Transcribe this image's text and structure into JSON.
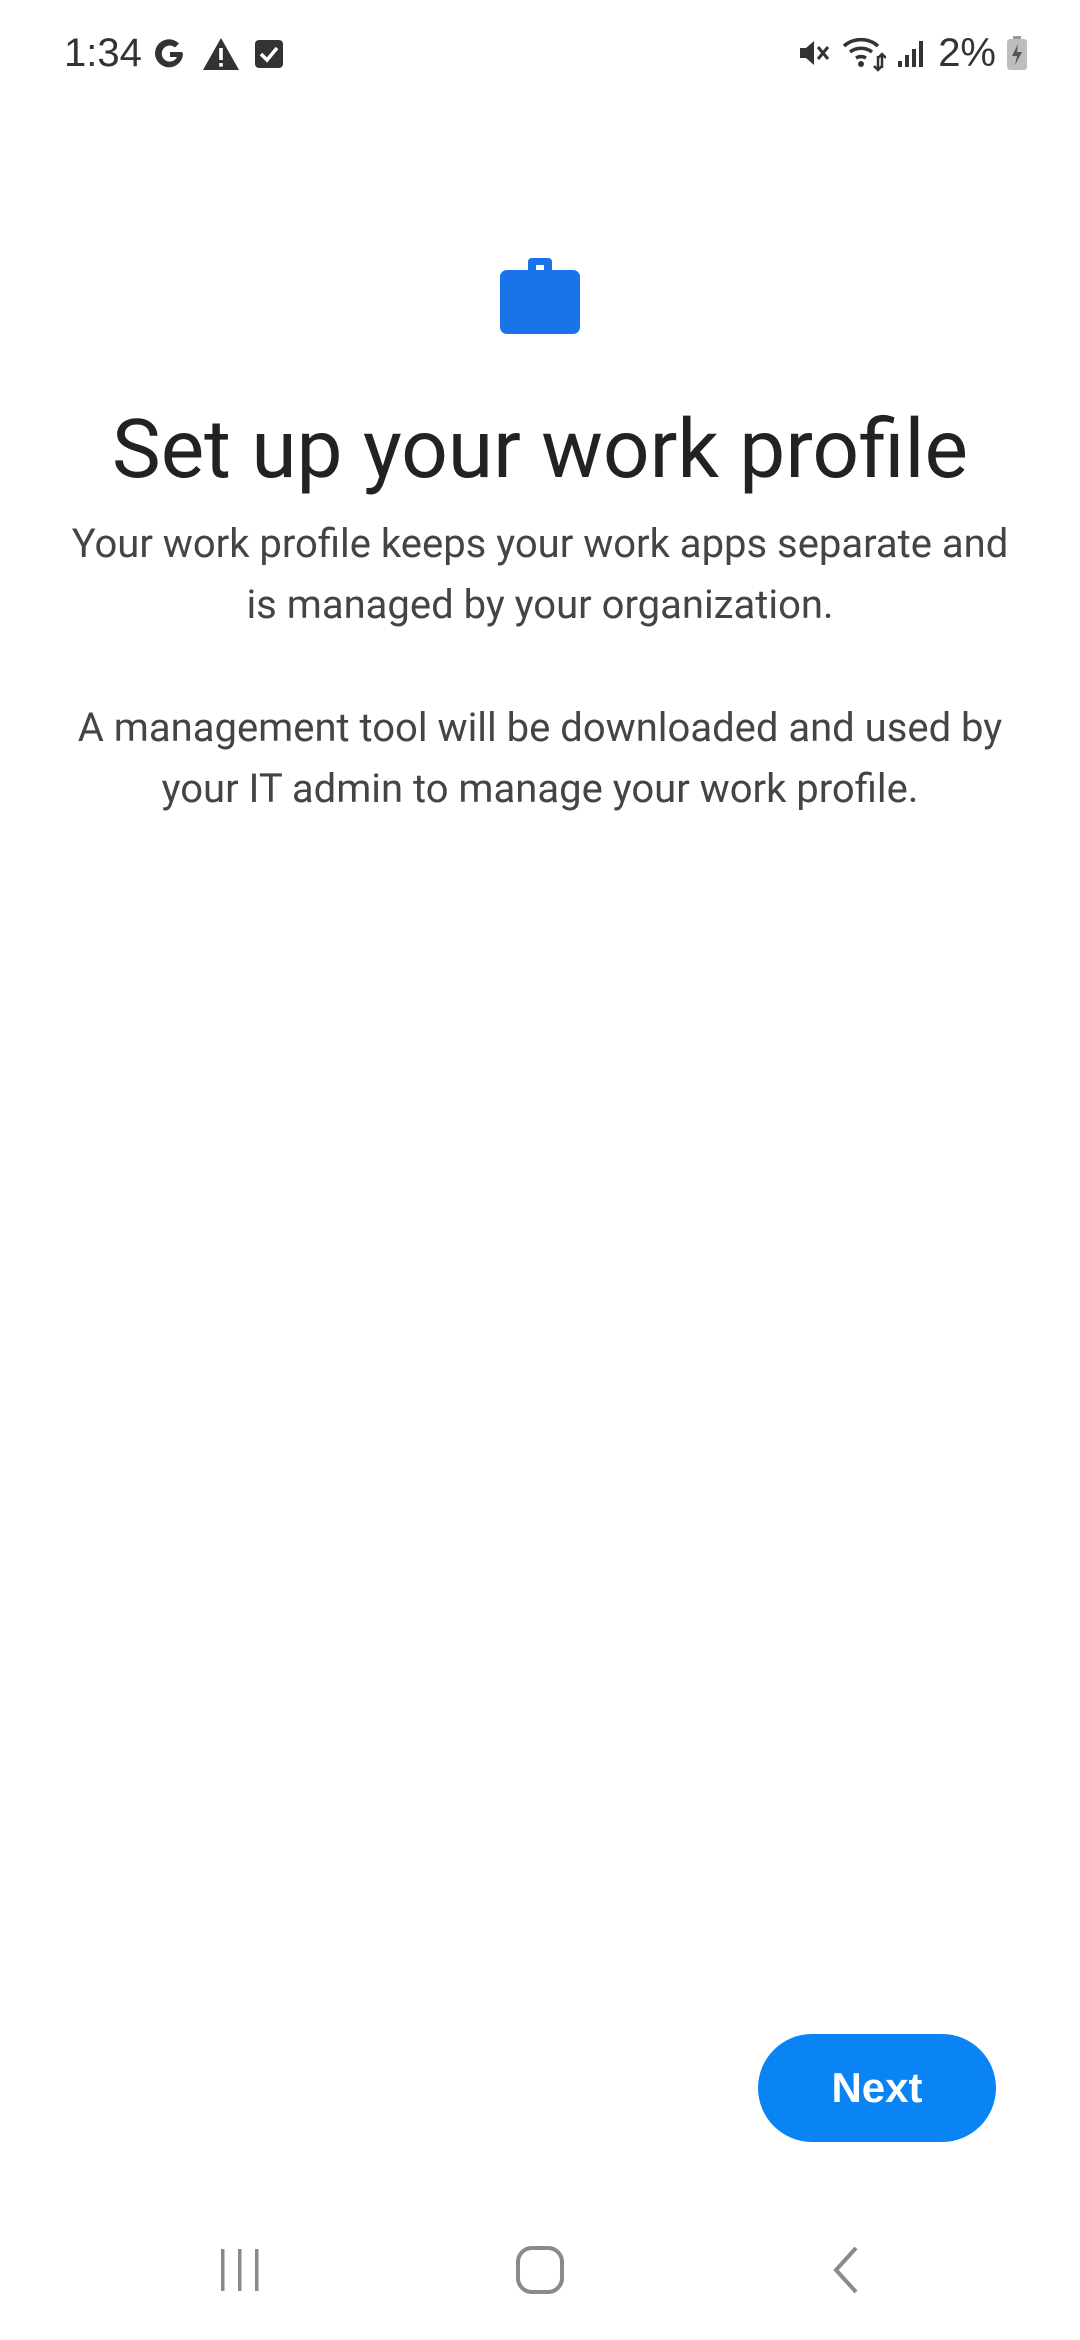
{
  "status_bar": {
    "time": "1:34",
    "left_icons": [
      "google-icon",
      "warning-icon",
      "checkbox-icon"
    ],
    "right_icons": [
      "mute-icon",
      "wifi-icon",
      "signal-icon"
    ],
    "battery_percent": "2%"
  },
  "content": {
    "icon": "briefcase-icon",
    "title": "Set up your work profile",
    "description_1": "Your work profile keeps your work apps separate and is managed by your organization.",
    "description_2": "A management tool will be downloaded and used by your IT admin to manage your work profile."
  },
  "actions": {
    "next_label": "Next"
  },
  "navigation": {
    "items": [
      "recents-icon",
      "home-icon",
      "back-icon"
    ]
  },
  "colors": {
    "accent": "#0a84f5",
    "briefcase": "#1a73e8",
    "title_text": "#222222",
    "body_text": "#444444",
    "nav_icons": "#8a8a8a"
  }
}
